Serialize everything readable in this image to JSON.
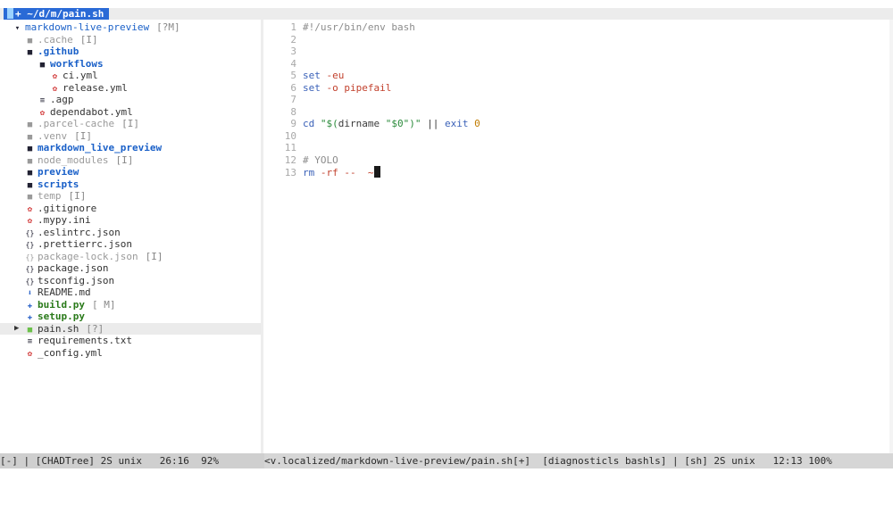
{
  "tab": {
    "path": "+ ~/d/m/pain.sh"
  },
  "tree": {
    "rows": [
      {
        "icon": "folder-open-icon",
        "glyph": "▾",
        "label": "markdown-live-preview",
        "badge": "[?M]",
        "style": "dir-plain",
        "indent": 2
      },
      {
        "icon": "folder-icon",
        "glyph": "■",
        "label": ".cache",
        "badge": "[I]",
        "style": "dim",
        "indent": 4
      },
      {
        "icon": "folder-icon",
        "glyph": "■",
        "label": ".github",
        "badge": "",
        "style": "dir-blue",
        "indent": 4
      },
      {
        "icon": "folder-icon",
        "glyph": "■",
        "label": "workflows",
        "badge": "",
        "style": "dir-blue",
        "indent": 6
      },
      {
        "icon": "gear-icon",
        "glyph": "✿",
        "label": "ci.yml",
        "badge": "",
        "style": "plain",
        "indent": 8
      },
      {
        "icon": "gear-icon",
        "glyph": "✿",
        "label": "release.yml",
        "badge": "",
        "style": "plain",
        "indent": 8
      },
      {
        "icon": "lines-icon",
        "glyph": "≡",
        "label": ".agp",
        "badge": "",
        "style": "plain",
        "indent": 6
      },
      {
        "icon": "gear-icon",
        "glyph": "✿",
        "label": "dependabot.yml",
        "badge": "",
        "style": "plain",
        "indent": 6
      },
      {
        "icon": "folder-icon",
        "glyph": "■",
        "label": ".parcel-cache",
        "badge": "[I]",
        "style": "dim",
        "indent": 4
      },
      {
        "icon": "folder-icon",
        "glyph": "■",
        "label": ".venv",
        "badge": "[I]",
        "style": "dim",
        "indent": 4
      },
      {
        "icon": "folder-icon",
        "glyph": "■",
        "label": "markdown_live_preview",
        "badge": "",
        "style": "dir-blue",
        "indent": 4
      },
      {
        "icon": "folder-icon",
        "glyph": "■",
        "label": "node_modules",
        "badge": "[I]",
        "style": "dim",
        "indent": 4
      },
      {
        "icon": "folder-icon",
        "glyph": "■",
        "label": "preview",
        "badge": "",
        "style": "dir-blue",
        "indent": 4
      },
      {
        "icon": "folder-icon",
        "glyph": "■",
        "label": "scripts",
        "badge": "",
        "style": "dir-blue",
        "indent": 4
      },
      {
        "icon": "folder-icon",
        "glyph": "■",
        "label": "temp",
        "badge": "[I]",
        "style": "dim",
        "indent": 4
      },
      {
        "icon": "gear-icon",
        "glyph": "✿",
        "label": ".gitignore",
        "badge": "",
        "style": "plain",
        "indent": 4
      },
      {
        "icon": "gear-icon",
        "glyph": "✿",
        "label": ".mypy.ini",
        "badge": "",
        "style": "plain",
        "indent": 4
      },
      {
        "icon": "braces-icon",
        "glyph": "{}",
        "label": ".eslintrc.json",
        "badge": "",
        "style": "plain",
        "indent": 4
      },
      {
        "icon": "braces-icon",
        "glyph": "{}",
        "label": ".prettierrc.json",
        "badge": "",
        "style": "plain",
        "indent": 4
      },
      {
        "icon": "braces-icon",
        "glyph": "{}",
        "label": "package-lock.json",
        "badge": "[I]",
        "style": "dim",
        "indent": 4
      },
      {
        "icon": "braces-icon",
        "glyph": "{}",
        "label": "package.json",
        "badge": "",
        "style": "plain",
        "indent": 4
      },
      {
        "icon": "braces-icon",
        "glyph": "{}",
        "label": "tsconfig.json",
        "badge": "",
        "style": "plain",
        "indent": 4
      },
      {
        "icon": "markdown-icon",
        "glyph": "⬇",
        "label": "README.md",
        "badge": "",
        "style": "plain",
        "indent": 4
      },
      {
        "icon": "python-icon",
        "glyph": "✚",
        "label": "build.py",
        "badge": "[ M]",
        "style": "file-green",
        "indent": 4
      },
      {
        "icon": "python-icon",
        "glyph": "✚",
        "label": "setup.py",
        "badge": "",
        "style": "file-green",
        "indent": 4
      },
      {
        "icon": "shell-icon",
        "glyph": "■",
        "label": "pain.sh",
        "badge": "[?]",
        "style": "plain",
        "indent": 4,
        "selected": true
      },
      {
        "icon": "lines-icon",
        "glyph": "≡",
        "label": "requirements.txt",
        "badge": "",
        "style": "plain",
        "indent": 4
      },
      {
        "icon": "gear-icon",
        "glyph": "✿",
        "label": "_config.yml",
        "badge": "",
        "style": "plain",
        "indent": 4
      }
    ]
  },
  "editor": {
    "lines": [
      {
        "n": "1",
        "tokens": [
          {
            "t": "#!/usr/bin/env bash",
            "c": "comment"
          }
        ]
      },
      {
        "n": "2",
        "tokens": []
      },
      {
        "n": "3",
        "tokens": []
      },
      {
        "n": "4",
        "tokens": []
      },
      {
        "n": "5",
        "tokens": [
          {
            "t": "set",
            "c": "keyword"
          },
          {
            "t": " -eu",
            "c": "flag"
          }
        ]
      },
      {
        "n": "6",
        "tokens": [
          {
            "t": "set",
            "c": "keyword"
          },
          {
            "t": " -o pipefail",
            "c": "flag"
          }
        ]
      },
      {
        "n": "7",
        "tokens": []
      },
      {
        "n": "8",
        "tokens": []
      },
      {
        "n": "9",
        "tokens": [
          {
            "t": "cd ",
            "c": "keyword"
          },
          {
            "t": "\"$(",
            "c": "string"
          },
          {
            "t": "dirname",
            "c": "plain"
          },
          {
            "t": " \"$0\"",
            "c": "string"
          },
          {
            "t": ")\"",
            "c": "string"
          },
          {
            "t": " || ",
            "c": "plain"
          },
          {
            "t": "exit",
            "c": "keyword"
          },
          {
            "t": " 0",
            "c": "num"
          }
        ]
      },
      {
        "n": "10",
        "tokens": []
      },
      {
        "n": "11",
        "tokens": []
      },
      {
        "n": "12",
        "tokens": [
          {
            "t": "# YOLO",
            "c": "comment"
          }
        ]
      },
      {
        "n": "13",
        "tokens": [
          {
            "t": "rm",
            "c": "keyword"
          },
          {
            "t": " -rf --  ",
            "c": "flag"
          },
          {
            "t": "~",
            "c": "tilde"
          }
        ],
        "caret": true
      }
    ]
  },
  "status": {
    "left": "[-] | [CHADTree] 2S unix   26:16  92%",
    "right": "<v.localized/markdown-live-preview/pain.sh[+]  [diagnosticls bashls] | [sh] 2S unix   12:13 100%"
  }
}
